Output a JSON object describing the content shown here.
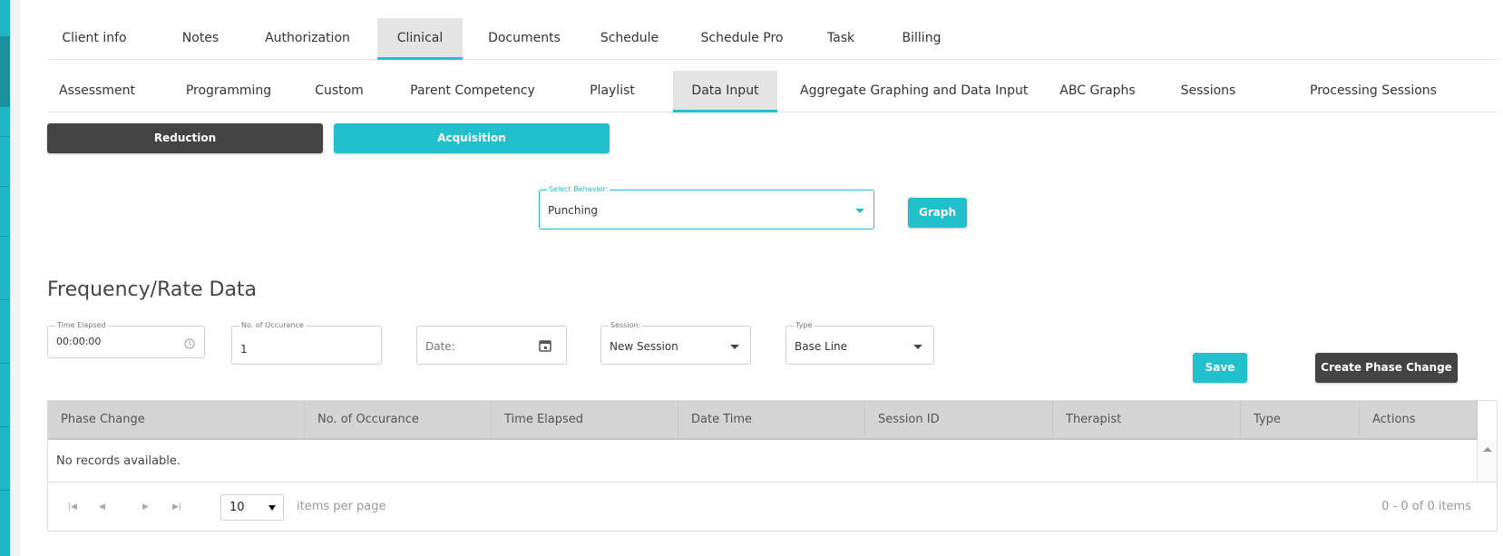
{
  "tabs_top": [
    {
      "label": "Client info",
      "active": false
    },
    {
      "label": "Notes",
      "active": false
    },
    {
      "label": "Authorization",
      "active": false
    },
    {
      "label": "Clinical",
      "active": true
    },
    {
      "label": "Documents",
      "active": false
    },
    {
      "label": "Schedule",
      "active": false
    },
    {
      "label": "Schedule Pro",
      "active": false
    },
    {
      "label": "Task",
      "active": false
    },
    {
      "label": "Billing",
      "active": false
    }
  ],
  "tabs_sub": [
    {
      "label": "Assessment",
      "active": false
    },
    {
      "label": "Programming",
      "active": false
    },
    {
      "label": "Custom",
      "active": false
    },
    {
      "label": "Parent Competency",
      "active": false
    },
    {
      "label": "Playlist",
      "active": false
    },
    {
      "label": "Data Input",
      "active": true
    },
    {
      "label": "Aggregate Graphing and Data Input",
      "active": false
    },
    {
      "label": "ABC Graphs",
      "active": false
    },
    {
      "label": "Sessions",
      "active": false
    },
    {
      "label": "Processing Sessions",
      "active": false
    }
  ],
  "mode_buttons": {
    "reduction": "Reduction",
    "acquisition": "Acquisition"
  },
  "behavior_select": {
    "label": "Select Behavior:",
    "value": "Punching"
  },
  "graph_button": "Graph",
  "section_title": "Frequency/Rate Data",
  "form": {
    "time_elapsed": {
      "label": "Time Elapsed",
      "value": "00:00:00"
    },
    "occurrence": {
      "label": "No. of Occurance",
      "value": "1"
    },
    "date": {
      "placeholder": "Date:"
    },
    "session": {
      "label": "Session:",
      "value": "New Session"
    },
    "type": {
      "label": "Type",
      "value": "Base Line"
    }
  },
  "save_button": "Save",
  "phase_button": "Create Phase Change",
  "table": {
    "columns": [
      "Phase Change",
      "No. of Occurance",
      "Time Elapsed",
      "Date Time",
      "Session ID",
      "Therapist",
      "Type",
      "Actions"
    ],
    "empty_text": "No records available."
  },
  "pager": {
    "page_size": "10",
    "items_per_page_label": "items per page",
    "summary": "0 - 0 of 0 items"
  },
  "colors": {
    "accent": "#22bfcc",
    "dark_button": "#444444",
    "header_bg": "#d4d4d4"
  },
  "icons": {
    "time": "clock-icon",
    "date": "calendar-icon",
    "dropdown": "caret-down-icon",
    "pager": [
      "first-page-icon",
      "prev-page-icon",
      "next-page-icon",
      "last-page-icon"
    ]
  }
}
